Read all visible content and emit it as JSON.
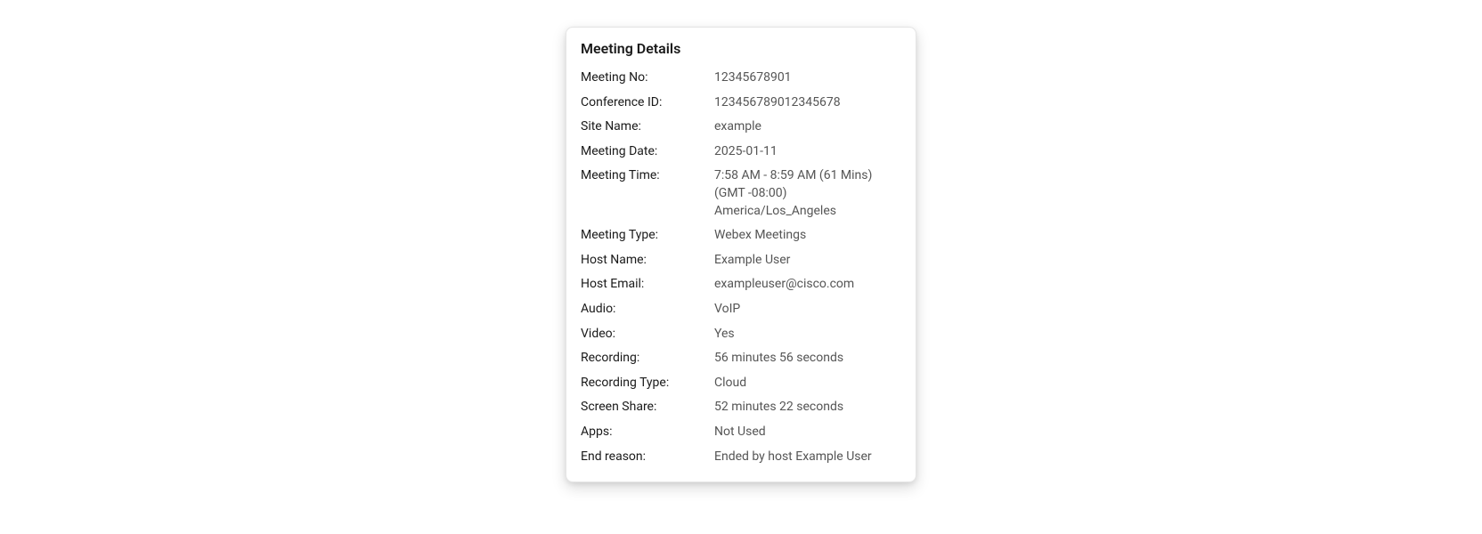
{
  "card": {
    "title": "Meeting Details",
    "rows": [
      {
        "label": "Meeting No:",
        "value": "12345678901"
      },
      {
        "label": "Conference ID:",
        "value": "123456789012345678"
      },
      {
        "label": "Site Name:",
        "value": "example"
      },
      {
        "label": "Meeting Date:",
        "value": "2025-01-11"
      },
      {
        "label": "Meeting Time:",
        "value": "7:58 AM - 8:59 AM (61 Mins) (GMT -08:00) America/Los_Angeles"
      },
      {
        "label": "Meeting Type:",
        "value": "Webex Meetings"
      },
      {
        "label": "Host Name:",
        "value": "Example User"
      },
      {
        "label": "Host Email:",
        "value": "exampleuser@cisco.com"
      },
      {
        "label": "Audio:",
        "value": "VoIP"
      },
      {
        "label": "Video:",
        "value": "Yes"
      },
      {
        "label": "Recording:",
        "value": "56 minutes 56 seconds"
      },
      {
        "label": "Recording Type:",
        "value": "Cloud"
      },
      {
        "label": "Screen Share:",
        "value": "52 minutes 22 seconds"
      },
      {
        "label": "Apps:",
        "value": "Not Used"
      },
      {
        "label": "End reason:",
        "value": "Ended by host Example User"
      }
    ]
  }
}
